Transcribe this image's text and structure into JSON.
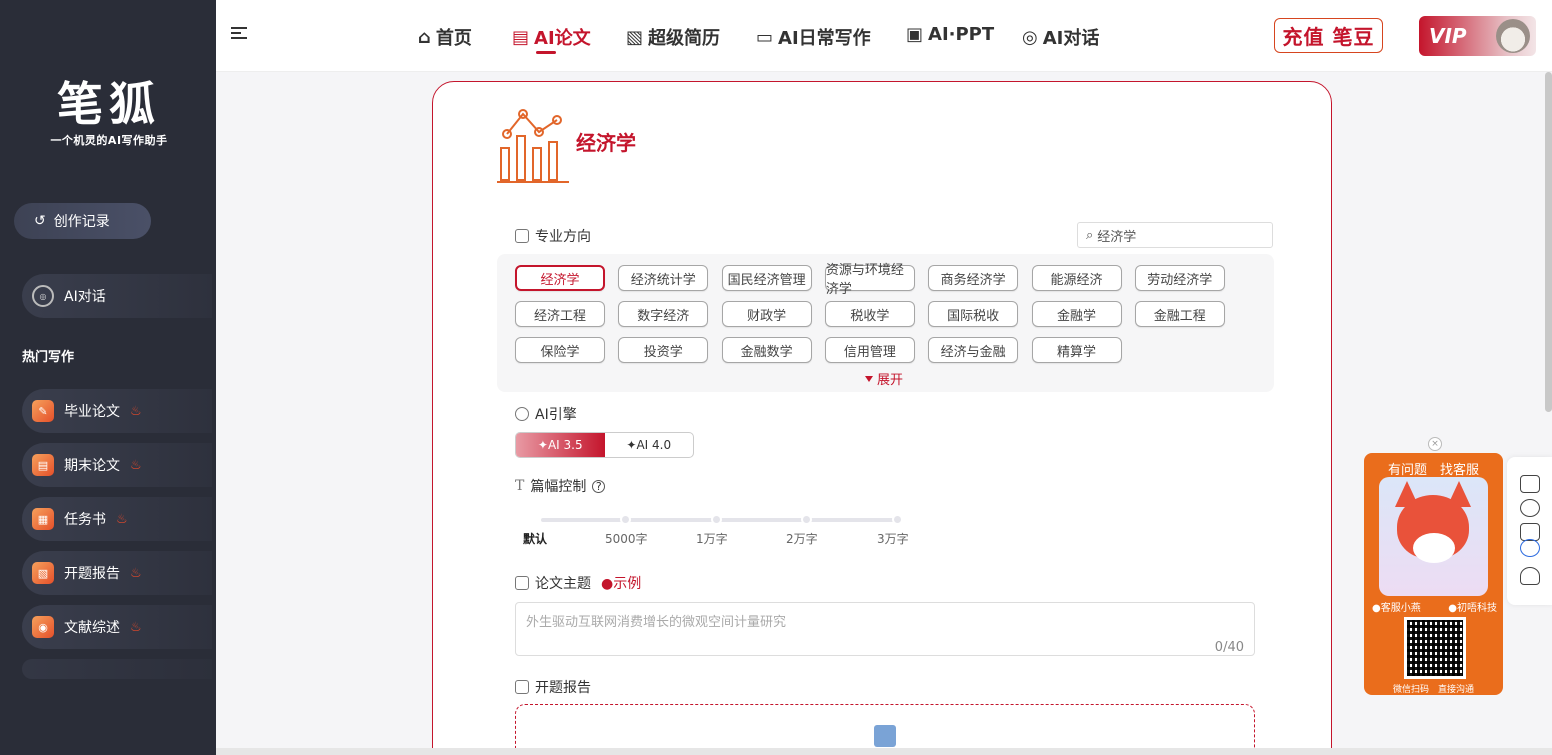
{
  "sidebar": {
    "logo_title": "笔狐",
    "logo_subtitle": "一个机灵的AI写作助手",
    "record_button": "创作记录",
    "ai_chat": "AI对话",
    "hot_section": "热门写作",
    "items": [
      {
        "label": "毕业论文"
      },
      {
        "label": "期末论文"
      },
      {
        "label": "任务书"
      },
      {
        "label": "开题报告"
      },
      {
        "label": "文献综述"
      }
    ]
  },
  "nav": {
    "items": [
      {
        "label": "首页"
      },
      {
        "label": "AI论文"
      },
      {
        "label": "超级简历"
      },
      {
        "label": "AI日常写作"
      },
      {
        "label": "AI·PPT"
      },
      {
        "label": "AI对话"
      }
    ],
    "recharge": "充值 笔豆",
    "vip": "VIP"
  },
  "main": {
    "heading": "经济学",
    "major_label": "专业方向",
    "search_value": "经济学",
    "tags": [
      "经济学",
      "经济统计学",
      "国民经济管理",
      "资源与环境经济学",
      "商务经济学",
      "能源经济",
      "劳动经济学",
      "经济工程",
      "数字经济",
      "财政学",
      "税收学",
      "国际税收",
      "金融学",
      "金融工程",
      "保险学",
      "投资学",
      "金融数学",
      "信用管理",
      "经济与金融",
      "精算学"
    ],
    "selected_tag": "经济学",
    "expand": "展开",
    "engine_label": "AI引擎",
    "engines": [
      "AI 3.5",
      "AI 4.0"
    ],
    "selected_engine": "AI 3.5",
    "length_label": "篇幅控制",
    "length_options": [
      "默认",
      "5000字",
      "1万字",
      "2万字",
      "3万字"
    ],
    "selected_length": "默认",
    "topic_label": "论文主题",
    "example": "示例",
    "topic_placeholder": "外生驱动互联网消费增长的微观空间计量研究",
    "counter": "0/40",
    "proposal_label": "开题报告"
  },
  "cs_widget": {
    "title": "有问题　找客服",
    "left_label": "客服小燕",
    "right_label": "初唔科技",
    "footer": "微信扫码　直接沟通"
  },
  "colors": {
    "brand": "#c4152c",
    "sidebar_bg": "#2a2d38",
    "cs_orange": "#ea6d1c"
  }
}
